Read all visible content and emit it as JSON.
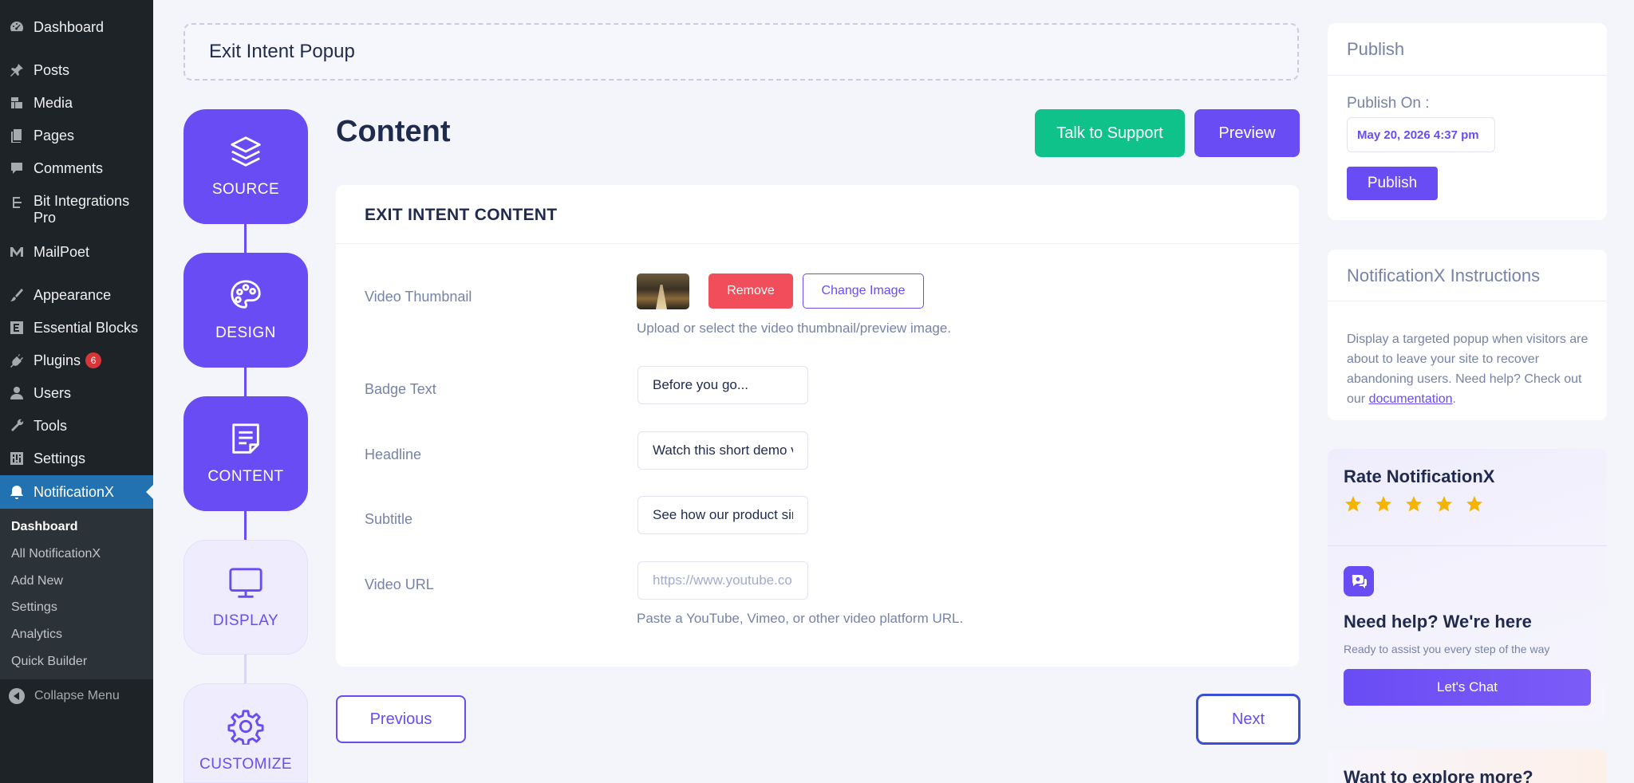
{
  "wp_menu": {
    "items": [
      {
        "label": "Dashboard",
        "icon": "dashboard-icon"
      },
      {
        "label": "Posts",
        "icon": "pin-icon"
      },
      {
        "label": "Media",
        "icon": "media-icon"
      },
      {
        "label": "Pages",
        "icon": "pages-icon"
      },
      {
        "label": "Comments",
        "icon": "comment-icon"
      },
      {
        "label": "Bit Integrations Pro",
        "icon": "bit-integrations-icon"
      },
      {
        "label": "MailPoet",
        "icon": "mailpoet-icon"
      },
      {
        "label": "Appearance",
        "icon": "brush-icon"
      },
      {
        "label": "Essential Blocks",
        "icon": "essential-blocks-icon"
      },
      {
        "label": "Plugins",
        "icon": "plugin-icon",
        "badge": "6"
      },
      {
        "label": "Users",
        "icon": "user-icon"
      },
      {
        "label": "Tools",
        "icon": "wrench-icon"
      },
      {
        "label": "Settings",
        "icon": "settings-icon"
      },
      {
        "label": "NotificationX",
        "icon": "notificationx-icon"
      }
    ],
    "submenu": [
      "Dashboard",
      "All NotificationX",
      "Add New",
      "Settings",
      "Analytics",
      "Quick Builder"
    ],
    "collapse_label": "Collapse Menu"
  },
  "page": {
    "title": "Exit Intent Popup",
    "heading": "Content"
  },
  "steps": [
    {
      "label": "SOURCE",
      "icon": "layers-icon",
      "state": "completed"
    },
    {
      "label": "DESIGN",
      "icon": "palette-icon",
      "state": "completed"
    },
    {
      "label": "CONTENT",
      "icon": "document-icon",
      "state": "active"
    },
    {
      "label": "DISPLAY",
      "icon": "monitor-icon",
      "state": "pending"
    },
    {
      "label": "CUSTOMIZE",
      "icon": "gear-icon",
      "state": "pending"
    }
  ],
  "header_buttons": {
    "support": "Talk to Support",
    "preview": "Preview"
  },
  "content_card": {
    "title": "EXIT INTENT CONTENT",
    "thumbnail": {
      "label": "Video Thumbnail",
      "remove": "Remove",
      "change": "Change Image",
      "help": "Upload or select the video thumbnail/preview image."
    },
    "badge_text": {
      "label": "Badge Text",
      "value": "Before you go..."
    },
    "headline": {
      "label": "Headline",
      "value": "Watch this short demo video"
    },
    "subtitle": {
      "label": "Subtitle",
      "value": "See how our product simplifies your workflow"
    },
    "video_url": {
      "label": "Video URL",
      "value": "",
      "placeholder": "https://www.youtube.com/watch?v=...",
      "help": "Paste a YouTube, Vimeo, or other video platform URL."
    }
  },
  "nav": {
    "previous": "Previous",
    "next": "Next"
  },
  "publish_panel": {
    "title": "Publish",
    "publish_on_label": "Publish On :",
    "date": "May 20, 2026 4:37 pm",
    "button": "Publish"
  },
  "instructions_panel": {
    "title": "NotificationX Instructions",
    "text": "Display a targeted popup when visitors are about to leave your site to recover abandoning users. Need help? Check out our ",
    "link": "documentation",
    "suffix": "."
  },
  "rate_panel": {
    "title": "Rate NotificationX",
    "stars": 5,
    "help_title": "Need help? We're here",
    "help_subtitle": "Ready to assist you every step of the way",
    "chat_button": "Let's Chat"
  },
  "explore_panel": {
    "title": "Want to explore more?"
  },
  "colors": {
    "accent": "#6a4cf5",
    "support_green": "#0fc28a",
    "remove_red": "#f14d5a",
    "wp_sidebar": "#1d2327",
    "wp_active": "#2271b1"
  }
}
